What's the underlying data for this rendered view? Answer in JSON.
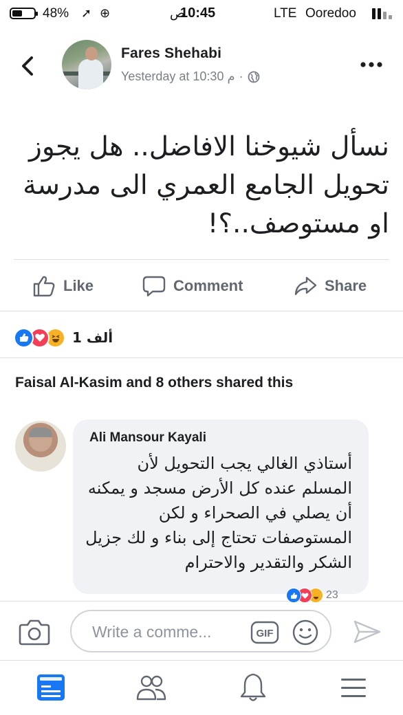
{
  "status_bar": {
    "battery": "48%",
    "time": "10:45",
    "time_suffix": "ص",
    "network": "LTE",
    "carrier": "Ooredoo"
  },
  "post": {
    "author": "Fares Shehabi",
    "timestamp": "Yesterday at 10:30 م",
    "meta_separator": "·",
    "privacy_icon": "globe-icon",
    "text": "نسأل شيوخنا الافاضل.. هل يجوز تحويل الجامع العمري الى مدرسة او مستوصف..؟!"
  },
  "actions": {
    "like": "Like",
    "comment": "Comment",
    "share": "Share"
  },
  "reactions": {
    "types": [
      "like",
      "love",
      "haha"
    ],
    "count": "1 ألف"
  },
  "shares": {
    "text": "Faisal Al-Kasim and 8 others shared this"
  },
  "comment": {
    "author": "Ali Mansour Kayali",
    "text": "أستاذي الغالي يجب التحويل لأن المسلم عنده كل الأرض مسجد و يمكنه أن يصلي في الصحراء و لكن المستوصفات تحتاج إلى بناء و لك جزيل الشكر والتقدير والاحترام",
    "reaction_count": "23"
  },
  "composer": {
    "placeholder": "Write a comme...",
    "gif_label": "GIF"
  },
  "colors": {
    "brand_blue": "#1877f2",
    "love_red": "#f33e58",
    "haha_yellow": "#f7b125",
    "muted_text": "#606770",
    "bubble_bg": "#f0f2f5"
  },
  "tab_bar": {
    "tabs": [
      "home-icon",
      "groups-icon",
      "notifications-icon",
      "menu-icon"
    ],
    "active": "home-icon"
  }
}
